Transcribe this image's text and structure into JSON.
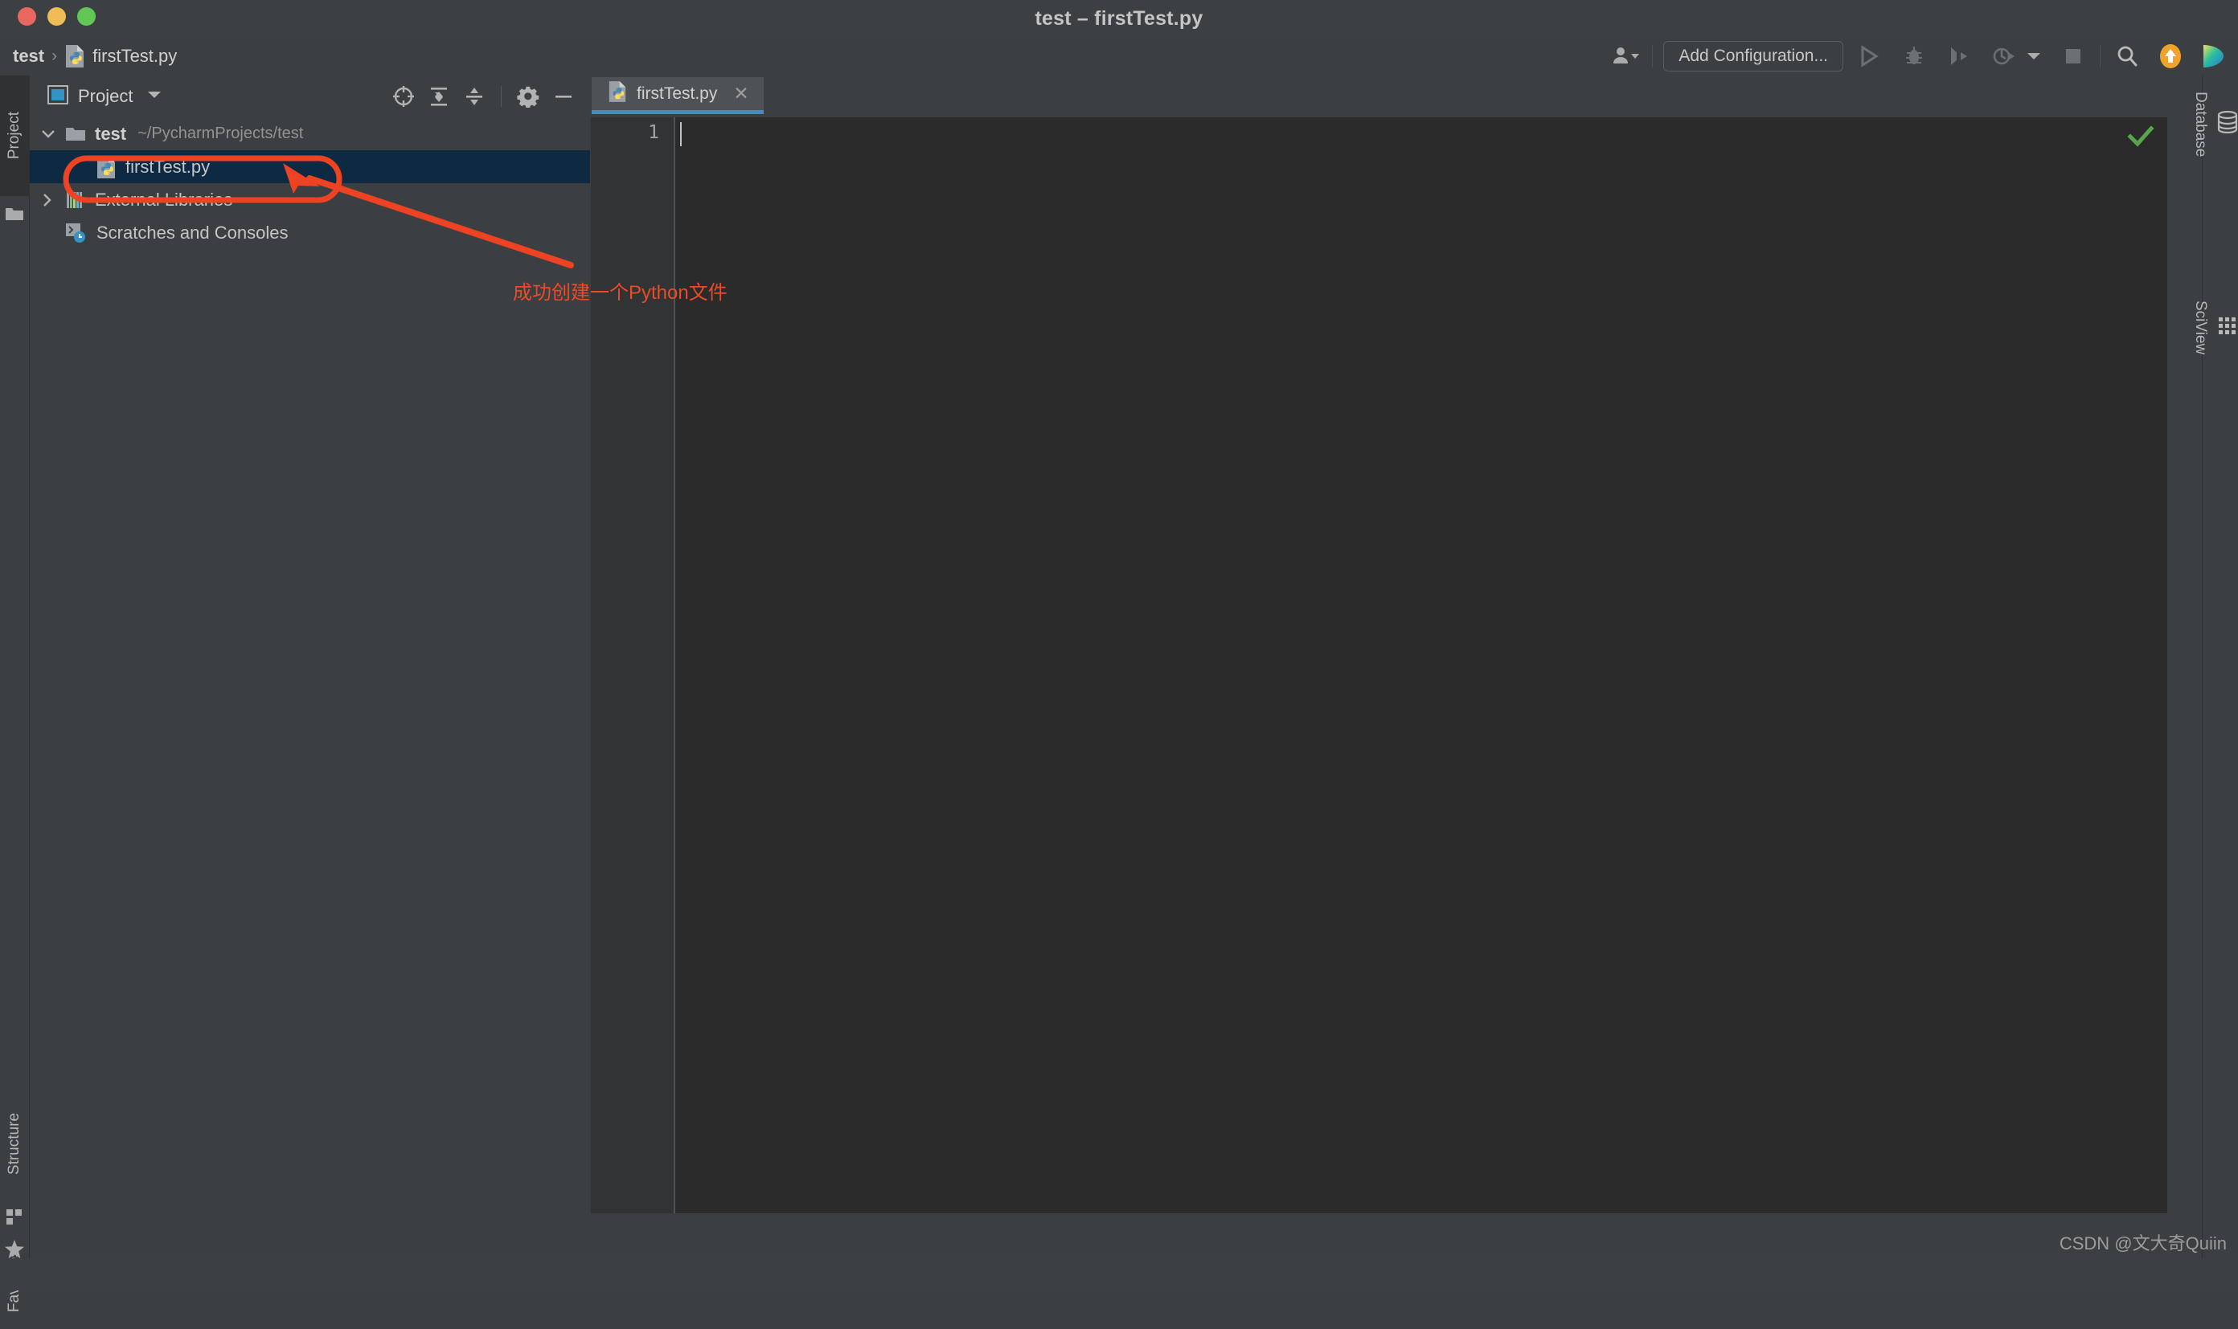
{
  "window": {
    "title": "test – firstTest.py",
    "traffic_lights": [
      "close",
      "minimize",
      "zoom"
    ]
  },
  "breadcrumb": {
    "root": "test",
    "separator": "›",
    "leaf": "firstTest.py"
  },
  "toolbar": {
    "account_icon": "user-avatar-icon",
    "add_configuration_label": "Add Configuration...",
    "run_icon": "run-play-icon",
    "debug_icon": "debug-bug-icon",
    "coverage_icon": "run-with-coverage-icon",
    "profile_icon": "profile-icon",
    "profile_dropdown_icon": "chevron-down-icon",
    "stop_icon": "stop-square-icon",
    "search_icon": "search-magnifier-icon",
    "update_icon": "update-arrow-up-icon",
    "jetbrains_icon": "toolbox-colorful-icon"
  },
  "left_strip": {
    "items": [
      {
        "label": "Project",
        "icon": "folder-icon",
        "active": true
      },
      {
        "label": "Structure",
        "icon": "structure-blocks-icon",
        "active": false
      },
      {
        "label": "Favorites",
        "icon": "star-icon",
        "active": false
      }
    ]
  },
  "right_strip": {
    "items": [
      {
        "label": "Database",
        "icon": "database-cylinder-icon"
      },
      {
        "label": "SciView",
        "icon": "sciview-grid-icon"
      }
    ]
  },
  "project_panel": {
    "title": "Project",
    "title_icon": "project-view-icon",
    "dropdown_icon": "chevron-down-icon",
    "actions": [
      {
        "name": "select-opened-file",
        "icon": "locate-target-icon"
      },
      {
        "name": "expand-all",
        "icon": "expand-all-icon"
      },
      {
        "name": "collapse-all",
        "icon": "collapse-all-icon"
      },
      {
        "name": "settings",
        "icon": "gear-icon"
      },
      {
        "name": "hide-panel",
        "icon": "minus-icon"
      }
    ],
    "tree": [
      {
        "label": "test",
        "path_hint": "~/PycharmProjects/test",
        "icon": "folder-icon",
        "expand_icon": "chevron-down-icon",
        "bold": true,
        "indent": 0,
        "selected": false
      },
      {
        "label": "firstTest.py",
        "path_hint": "",
        "icon": "python-file-icon",
        "expand_icon": "",
        "bold": false,
        "indent": 1,
        "selected": true
      },
      {
        "label": "External Libraries",
        "path_hint": "",
        "icon": "library-bars-icon",
        "expand_icon": "chevron-right-icon",
        "bold": false,
        "indent": 0,
        "selected": false
      },
      {
        "label": "Scratches and Consoles",
        "path_hint": "",
        "icon": "scratches-console-icon",
        "expand_icon": "",
        "bold": false,
        "indent": 0,
        "selected": false
      }
    ]
  },
  "editor": {
    "tabs": [
      {
        "label": "firstTest.py",
        "icon": "python-file-icon",
        "close_icon": "close-x-icon",
        "active": true
      }
    ],
    "line_numbers": [
      "1"
    ],
    "content": "",
    "inspection_status_icon": "inspection-ok-check-icon",
    "inspection_status_color": "#57a64a"
  },
  "annotation": {
    "text": "成功创建一个Python文件",
    "color": "#ec4a28",
    "shapes": [
      "ellipse-highlight",
      "arrow-pointer",
      "leader-line"
    ]
  },
  "watermark": {
    "text": "CSDN @文大奇Quiin"
  },
  "colors": {
    "titlebar_bg": "#3c4043",
    "chrome_bg": "#3c3f41",
    "editor_bg": "#2b2b2b",
    "gutter_bg": "#313335",
    "selection_bg": "#0d2a42",
    "tab_active_bg": "#4e5254",
    "tab_underline": "#4a88c7",
    "text_primary": "#c3c5c7",
    "text_secondary": "#919395",
    "annotation_red": "#ec4a28",
    "check_green": "#57a64a",
    "update_orange": "#f0a32a"
  }
}
